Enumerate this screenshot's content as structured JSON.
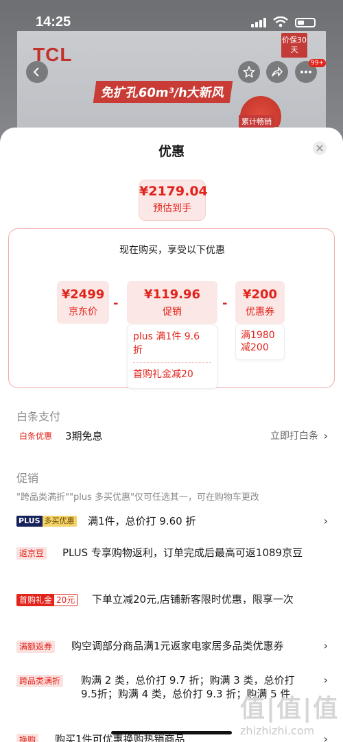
{
  "status_bar": {
    "time": "14:25"
  },
  "background_page": {
    "brand_logo": "TCL",
    "promo_tag": "价保30天",
    "banner_text": "免扩孔60m³/h大新风",
    "sales_tag": "累计畅销",
    "more_badge": "99+",
    "icons": [
      "back-icon",
      "star-icon",
      "share-icon",
      "more-icon"
    ]
  },
  "sheet": {
    "title": "优惠",
    "close_icon": "close-icon",
    "estimated": {
      "amount": "¥2179.04",
      "label": "预估到手"
    },
    "breakdown": {
      "header": "现在购买，享受以下优惠",
      "jd_price": {
        "amount": "¥2499",
        "label": "京东价"
      },
      "promo": {
        "amount": "¥119.96",
        "label": "促销",
        "details": [
          "plus 满1件 9.6 折",
          "首购礼金减20"
        ]
      },
      "coupon": {
        "amount": "¥200",
        "label": "优惠券",
        "details": [
          "满1980减200"
        ]
      },
      "operator": "-"
    },
    "baitiao": {
      "section_title": "白条支付",
      "tag": "白条优惠",
      "text": "3期免息",
      "action": "立即打白条"
    },
    "promotions": {
      "section_title": "促销",
      "hint": "\"跨品类满折\"\"plus 多买优惠\"仅可任选其一，可在购物车更改",
      "items": [
        {
          "tag_left": "PLUS",
          "tag_right": "多买优惠",
          "text": "满1件，总价打 9.60 折",
          "has_chevron": true
        },
        {
          "tag": "返京豆",
          "text": "PLUS 专享购物返利，订单完成后最高可返1089京豆",
          "has_chevron": false
        },
        {
          "tag_left": "首购礼金",
          "tag_right": "20元",
          "text": "下单立减20元,店铺新客限时优惠，限享一次",
          "has_chevron": false
        },
        {
          "tag": "满额返券",
          "text": "购空调部分商品满1元返家电家居多品类优惠券",
          "has_chevron": true
        },
        {
          "tag": "跨品类满折",
          "text": "购满 2 类，总价打 9.7 折；购满 3 类，总价打 9.5折；购满 4 类，总价打 9.3 折；购满 5 件",
          "has_chevron": true
        },
        {
          "tag": "换购",
          "text": "购买1件可优惠换购热销商品",
          "has_chevron": true
        }
      ]
    }
  },
  "watermark": {
    "big": "值|值|值",
    "url": "zhizhizhi.com"
  },
  "colors": {
    "accent": "#e2231a",
    "accent_light": "#fbe7e6",
    "plus_dark": "#17215a",
    "plus_gold": "#f3d36a"
  }
}
